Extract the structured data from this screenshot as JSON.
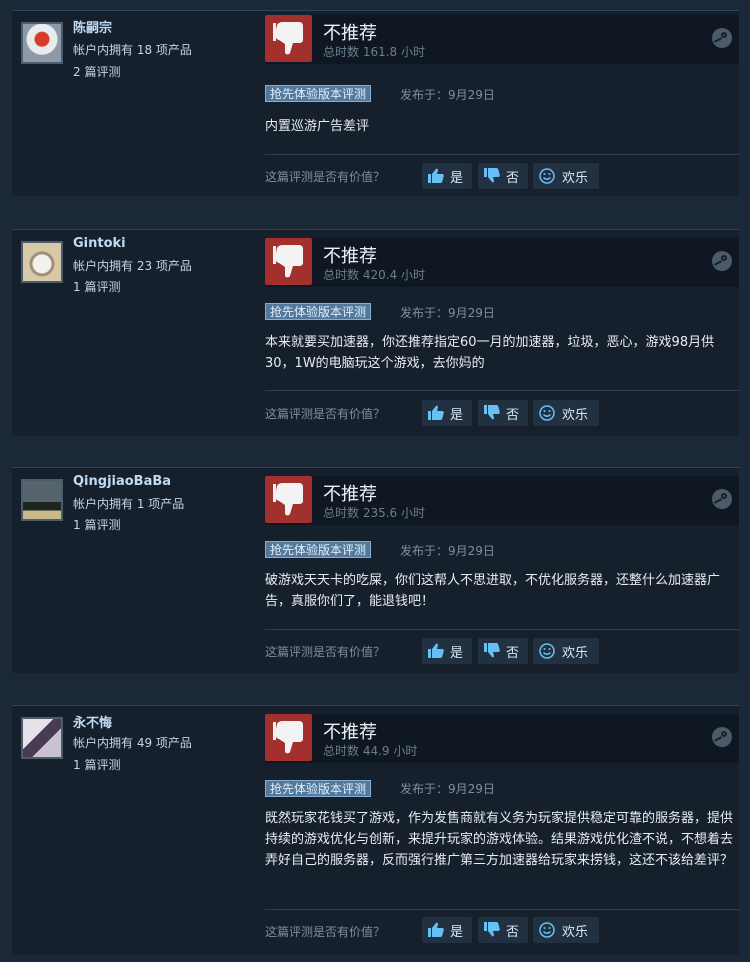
{
  "colors": {
    "page_bg": "#1b2838",
    "card_bg": "#16202d",
    "thumb_down_bg": "#a2302d",
    "tag_bg": "#52799c",
    "username": "#c1dbf4"
  },
  "icons": {
    "verdict": "thumbs-down-icon",
    "platform": "steam-icon",
    "yes": "thumbs-up-icon",
    "no": "thumbs-down-icon",
    "funny": "smiley-icon"
  },
  "reviews": [
    {
      "user": {
        "name": "陈嗣宗",
        "products": "帐户内拥有 18 项产品",
        "reviews": "2 篇评测"
      },
      "verdict": "不推荐",
      "hours": "总时数 161.8 小时",
      "tag": "抢先体验版本评测",
      "posted": "发布于：9月29日",
      "text": "内置巡游广告差评",
      "helpful_q": "这篇评测是否有价值？",
      "yes": "是",
      "no": "否",
      "funny": "欢乐"
    },
    {
      "user": {
        "name": "Gintoki",
        "products": "帐户内拥有 23 项产品",
        "reviews": "1 篇评测"
      },
      "verdict": "不推荐",
      "hours": "总时数 420.4 小时",
      "tag": "抢先体验版本评测",
      "posted": "发布于：9月29日",
      "text": "本来就要买加速器，你还推荐指定60一月的加速器，垃圾，恶心，游戏98月供30，1W的电脑玩这个游戏，去你妈的",
      "helpful_q": "这篇评测是否有价值？",
      "yes": "是",
      "no": "否",
      "funny": "欢乐"
    },
    {
      "user": {
        "name": "QingjiaoBaBa",
        "products": "帐户内拥有 1 项产品",
        "reviews": "1 篇评测"
      },
      "verdict": "不推荐",
      "hours": "总时数 235.6 小时",
      "tag": "抢先体验版本评测",
      "posted": "发布于：9月29日",
      "text": "破游戏天天卡的吃屎，你们这帮人不思进取，不优化服务器，还整什么加速器广告，真服你们了，能退钱吧！",
      "helpful_q": "这篇评测是否有价值？",
      "yes": "是",
      "no": "否",
      "funny": "欢乐"
    },
    {
      "user": {
        "name": "永不悔",
        "products": "帐户内拥有 49 项产品",
        "reviews": "1 篇评测"
      },
      "verdict": "不推荐",
      "hours": "总时数 44.9 小时",
      "tag": "抢先体验版本评测",
      "posted": "发布于：9月29日",
      "text": "既然玩家花钱买了游戏，作为发售商就有义务为玩家提供稳定可靠的服务器，提供持续的游戏优化与创新，来提升玩家的游戏体验。结果游戏优化渣不说，不想着去弄好自己的服务器，反而强行推广第三方加速器给玩家来捞钱，这还不该给差评？",
      "helpful_q": "这篇评测是否有价值？",
      "yes": "是",
      "no": "否",
      "funny": "欢乐"
    }
  ]
}
